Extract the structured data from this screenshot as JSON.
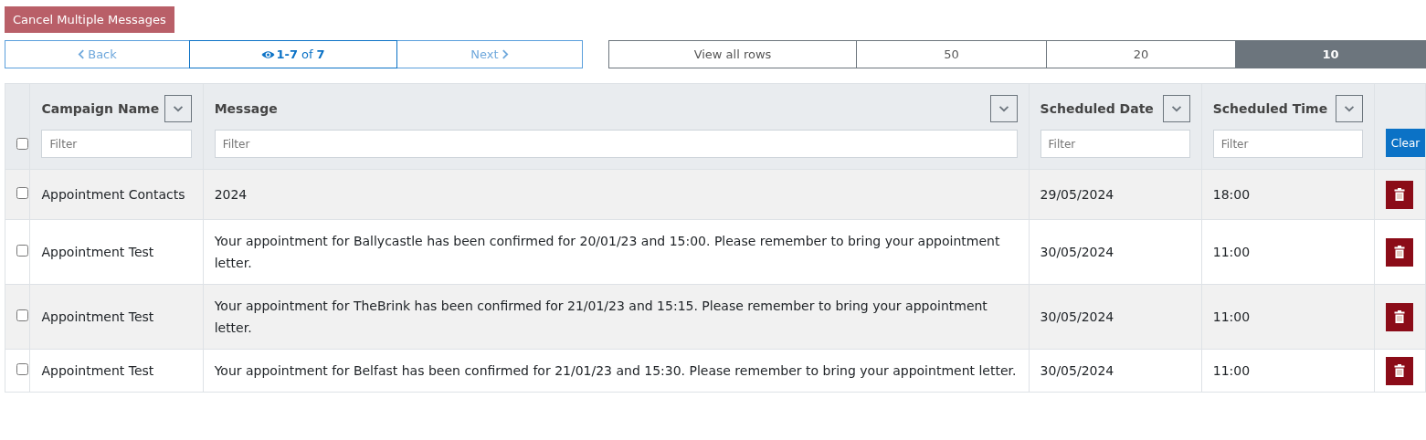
{
  "cancel_button": "Cancel Multiple Messages",
  "pagination": {
    "back": "Back",
    "range": "1-7",
    "of": "of",
    "total": "7",
    "next": "Next",
    "back_disabled": true,
    "next_disabled": true
  },
  "page_sizes": [
    {
      "label": "View all rows",
      "selected": false
    },
    {
      "label": "50",
      "selected": false
    },
    {
      "label": "20",
      "selected": false
    },
    {
      "label": "10",
      "selected": true
    }
  ],
  "table": {
    "select_all_checked": false,
    "columns": [
      {
        "title": "Campaign Name",
        "placeholder": "Filter"
      },
      {
        "title": "Message",
        "placeholder": "Filter"
      },
      {
        "title": "Scheduled Date",
        "placeholder": "Filter"
      },
      {
        "title": "Scheduled Time",
        "placeholder": "Filter"
      }
    ],
    "clear_button": "Clear",
    "rows": [
      {
        "checked": false,
        "campaign": "Appointment Contacts",
        "message": "2024",
        "date": "29/05/2024",
        "time": "18:00"
      },
      {
        "checked": false,
        "campaign": "Appointment Test",
        "message": "Your appointment for Ballycastle has been confirmed for 20/01/23 and 15:00. Please remember to bring your appointment letter.",
        "date": "30/05/2024",
        "time": "11:00"
      },
      {
        "checked": false,
        "campaign": "Appointment Test",
        "message": "Your appointment for TheBrink has been confirmed for 21/01/23 and 15:15. Please remember to bring your appointment letter.",
        "date": "30/05/2024",
        "time": "11:00"
      },
      {
        "checked": false,
        "campaign": "Appointment Test",
        "message": "Your appointment for Belfast has been confirmed for 21/01/23 and 15:30. Please remember to bring your appointment letter.",
        "date": "30/05/2024",
        "time": "11:00"
      }
    ]
  }
}
